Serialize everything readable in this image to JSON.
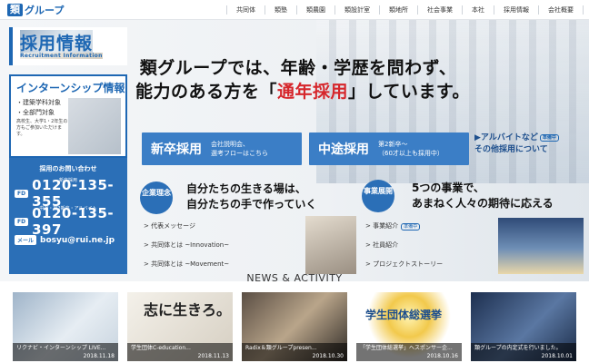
{
  "header": {
    "logo_mark": "類",
    "logo_text": "グループ",
    "nav": [
      "共同体",
      "類塾",
      "類農園",
      "類設計室",
      "類地所",
      "社会事業",
      "本社",
      "採用情報",
      "会社概要"
    ]
  },
  "sidebar": {
    "title": "採用情報",
    "subtitle": "Recruitment Information",
    "intern": {
      "title": "インターンシップ情報",
      "bullet1": "・建築学科対象",
      "bullet2": "・全部門対象",
      "note": "高校生、大学1・2年生の方もご参加いただけます。"
    },
    "contact": {
      "heading": "採用のお問い合わせ",
      "label1": "新卒採用",
      "fd_badge": "FD",
      "phone1": "0120-135-355",
      "label2": "中途・第2新卒・アルバイト",
      "phone2": "0120-135-397",
      "mail_label": "メール",
      "mail": "bosyu@rui.ne.jp"
    }
  },
  "hero": {
    "line1": "類グループでは、年齢・学歴を問わず、",
    "line2_a": "能力のある方を「",
    "line2_red": "通年採用",
    "line2_b": "」しています。",
    "new_grad": {
      "title": "新卒採用",
      "desc1": "会社説明会、",
      "desc2": "選考フローはこちら"
    },
    "mid_career": {
      "title": "中途採用",
      "desc1": "第2新卒〜",
      "desc2": "（60才以上も採用中）"
    },
    "arbeit": {
      "line1": "▶アルバイトなど",
      "badge": "準備中",
      "line2": "その他採用について"
    }
  },
  "philosophy": {
    "badge": "企業理念",
    "line1": "自分たちの生きる場は、",
    "line2": "自分たちの手で作っていく",
    "links": [
      "代表メッセージ",
      "共同体とは ~Innovation~",
      "共同体とは ~Movement~"
    ]
  },
  "business": {
    "badge": "事業展開",
    "line1": "5つの事業で、",
    "line2": "あまねく人々の期待に応える",
    "links": [
      "事業紹介",
      "社員紹介",
      "プロジェクトストーリー"
    ],
    "prep_badge": "準備中"
  },
  "news": {
    "title": "NEWS & ACTIVITY",
    "items": [
      {
        "caption": "リクナビ・インターンシップ LIVE...",
        "date": "2018.11.18"
      },
      {
        "caption": "学生団体C-education...",
        "date": "2018.11.13"
      },
      {
        "caption": "Radix＆類グループpresen...",
        "date": "2018.10.30"
      },
      {
        "caption": "「学生団体総選挙」へスポンサー企...",
        "date": "2018.10.16"
      },
      {
        "caption": "類グループの内定式を行いました。",
        "date": "2018.10.01"
      }
    ],
    "thumb2_text": "志に生きろ。",
    "thumb4_text": "学生団体総選挙"
  }
}
